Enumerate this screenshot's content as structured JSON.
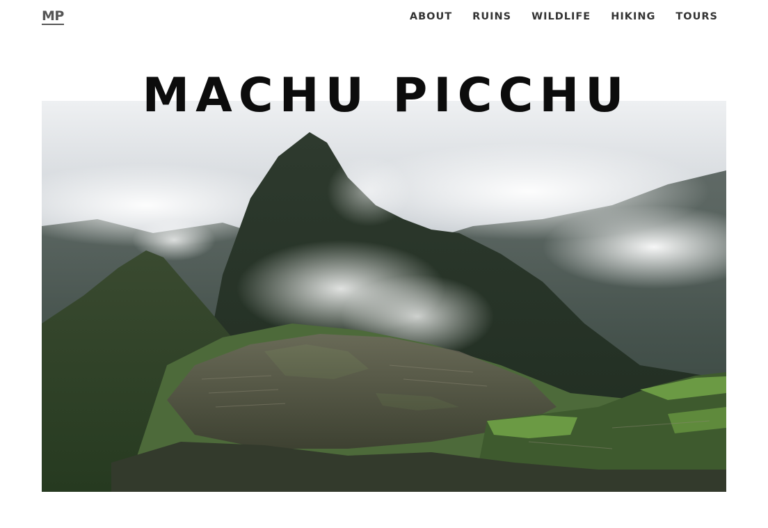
{
  "header": {
    "logo_text": "MP",
    "nav": [
      {
        "label": "ABOUT"
      },
      {
        "label": "RUINS"
      },
      {
        "label": "WILDLIFE"
      },
      {
        "label": "HIKING"
      },
      {
        "label": "TOURS"
      }
    ]
  },
  "hero": {
    "title": "MACHU PICCHU",
    "image_icon": "mountain-photo"
  }
}
